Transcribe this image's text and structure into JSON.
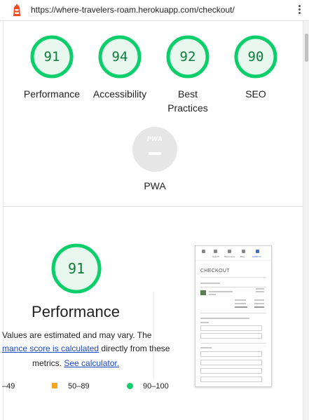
{
  "browser": {
    "url": "https://where-travelers-roam.herokuapp.com/checkout/",
    "icon": "lighthouse-icon",
    "menu_icon": "kebab-menu-icon"
  },
  "scores": [
    {
      "name": "Performance",
      "value": 91
    },
    {
      "name": "Accessibility",
      "value": 94
    },
    {
      "name": "Best Practices",
      "value": 92
    },
    {
      "name": "SEO",
      "value": 90
    }
  ],
  "pwa": {
    "badge": "PWA",
    "label": "PWA"
  },
  "performance": {
    "score": 91,
    "title": "Performance",
    "desc_line1": "Values are estimated and may vary. The",
    "desc_link1": "mance score is calculated",
    "desc_line2_rest": " directly from these",
    "desc_line3": "metrics. ",
    "desc_link2": "See calculator."
  },
  "legend": {
    "fail": "–49",
    "average": "50–89",
    "pass": "90–100"
  },
  "colors": {
    "pass": "#0cce6b",
    "pass_fill": "#e8f8ee",
    "average": "#f5a623",
    "link": "#1a48c7"
  },
  "thumbnail": {
    "heading": "CHECKOUT",
    "nav_items": [
      "Search",
      "MyAccount",
      "Blog",
      "£1800.00"
    ]
  }
}
